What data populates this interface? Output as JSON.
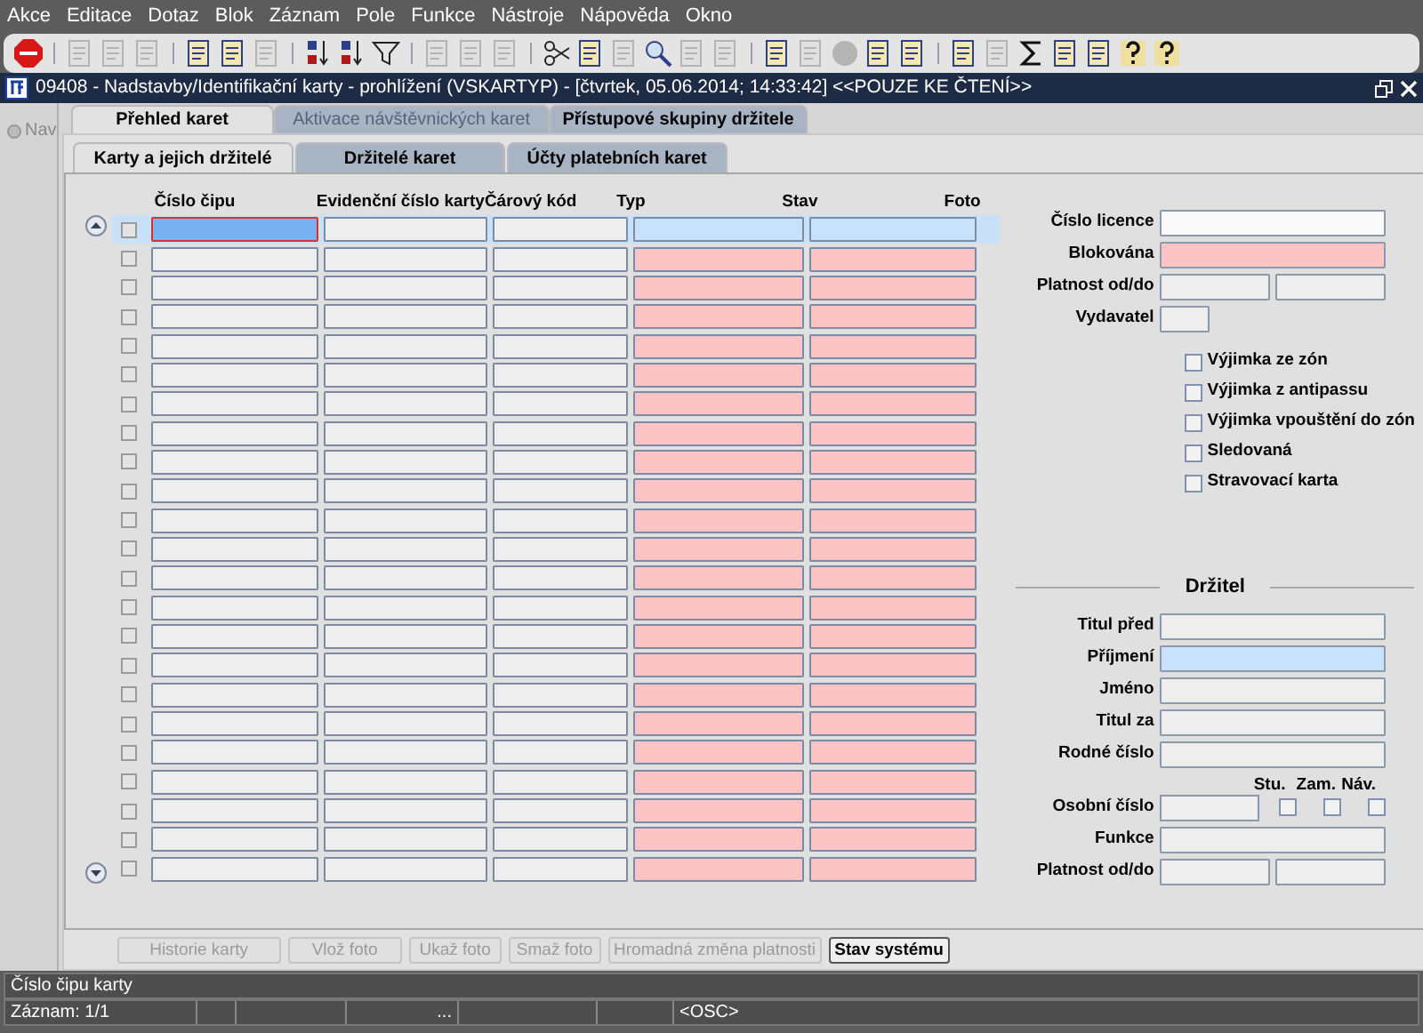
{
  "menu": [
    "Akce",
    "Editace",
    "Dotaz",
    "Blok",
    "Záznam",
    "Pole",
    "Funkce",
    "Nástroje",
    "Nápověda",
    "Okno"
  ],
  "toolbar": [
    [
      {
        "kind": "stop",
        "disabled": false
      }
    ],
    [
      {
        "kind": "doc",
        "disabled": true
      },
      {
        "kind": "doc",
        "disabled": true
      },
      {
        "kind": "doc",
        "disabled": true
      }
    ],
    [
      {
        "kind": "doc",
        "disabled": false
      },
      {
        "kind": "doc",
        "disabled": false
      },
      {
        "kind": "doc",
        "disabled": true
      }
    ],
    [
      {
        "kind": "sort",
        "disabled": false
      },
      {
        "kind": "sort",
        "disabled": false
      },
      {
        "kind": "filter",
        "disabled": false
      }
    ],
    [
      {
        "kind": "doc",
        "disabled": true
      },
      {
        "kind": "doc",
        "disabled": true
      },
      {
        "kind": "doc",
        "disabled": true
      }
    ],
    [
      {
        "kind": "scissors",
        "disabled": false
      },
      {
        "kind": "doc",
        "disabled": false
      },
      {
        "kind": "doc",
        "disabled": true
      },
      {
        "kind": "search",
        "disabled": false
      },
      {
        "kind": "doc",
        "disabled": true
      },
      {
        "kind": "doc",
        "disabled": true
      }
    ],
    [
      {
        "kind": "doc",
        "disabled": false
      },
      {
        "kind": "doc",
        "disabled": true
      },
      {
        "kind": "globe",
        "disabled": true
      },
      {
        "kind": "doc",
        "disabled": false
      },
      {
        "kind": "doc",
        "disabled": false
      }
    ],
    [
      {
        "kind": "doc",
        "disabled": false
      },
      {
        "kind": "doc",
        "disabled": true
      },
      {
        "kind": "sum",
        "disabled": false
      },
      {
        "kind": "doc",
        "disabled": false
      },
      {
        "kind": "doc",
        "disabled": false
      },
      {
        "kind": "help",
        "disabled": false
      },
      {
        "kind": "help",
        "disabled": false
      }
    ]
  ],
  "window": {
    "title": "09408 - Nadstavby/Identifikační karty - prohlížení (VSKARTYP) - [čtvrtek, 05.06.2014; 14:33:42] <<POUZE KE ČTENÍ>>"
  },
  "nav": {
    "label": "Nav",
    "disabled": true
  },
  "tabs": [
    {
      "label": "Přehled karet",
      "selected": true,
      "disabled": false
    },
    {
      "label": "Aktivace návštěvnických karet",
      "selected": false,
      "disabled": true
    },
    {
      "label": "Přístupové skupiny držitele",
      "selected": false,
      "disabled": false
    }
  ],
  "subtabs": [
    {
      "label": "Karty a jejich držitelé",
      "selected": true
    },
    {
      "label": "Držitelé karet",
      "selected": false
    },
    {
      "label": "Účty platebních karet",
      "selected": false
    }
  ],
  "table": {
    "columns": [
      {
        "label": "Číslo čipu",
        "required": false
      },
      {
        "label": "Evidenční číslo karty",
        "required": false
      },
      {
        "label": "Čárový kód",
        "required": false
      },
      {
        "label": "Typ",
        "required": true
      },
      {
        "label": "Stav",
        "required": true
      },
      {
        "label": "Foto"
      }
    ],
    "rows": [
      {
        "selected": true,
        "checked": false
      },
      {
        "selected": false,
        "checked": false
      },
      {
        "selected": false,
        "checked": false
      },
      {
        "selected": false,
        "checked": false
      },
      {
        "selected": false,
        "checked": false
      },
      {
        "selected": false,
        "checked": false
      },
      {
        "selected": false,
        "checked": false
      },
      {
        "selected": false,
        "checked": false
      },
      {
        "selected": false,
        "checked": false
      },
      {
        "selected": false,
        "checked": false
      },
      {
        "selected": false,
        "checked": false
      },
      {
        "selected": false,
        "checked": false
      },
      {
        "selected": false,
        "checked": false
      },
      {
        "selected": false,
        "checked": false
      },
      {
        "selected": false,
        "checked": false
      },
      {
        "selected": false,
        "checked": false
      },
      {
        "selected": false,
        "checked": false
      },
      {
        "selected": false,
        "checked": false
      },
      {
        "selected": false,
        "checked": false
      },
      {
        "selected": false,
        "checked": false
      },
      {
        "selected": false,
        "checked": false
      },
      {
        "selected": false,
        "checked": false
      },
      {
        "selected": false,
        "checked": false
      }
    ]
  },
  "card_fields": [
    {
      "label": "Číslo licence",
      "kind": "wide",
      "required": false,
      "highlighted": false
    },
    {
      "label": "Blokována",
      "kind": "wide",
      "required": true,
      "highlighted": false
    },
    {
      "label": "Platnost od/do",
      "kind": "pair",
      "required": false,
      "highlighted": false
    },
    {
      "label": "Vydavatel",
      "kind": "short",
      "required": false,
      "highlighted": false
    }
  ],
  "card_checkboxes": [
    {
      "label": "Výjimka ze zón",
      "checked": false
    },
    {
      "label": "Výjimka z antipassu",
      "checked": false
    },
    {
      "label": "Výjimka vpouštění do zón",
      "checked": false
    },
    {
      "label": "Sledovaná",
      "checked": false
    },
    {
      "label": "Stravovací karta",
      "checked": false
    }
  ],
  "holder": {
    "title": "Držitel",
    "fields": [
      {
        "label": "Titul před",
        "kind": "wide",
        "highlighted": false
      },
      {
        "label": "Příjmení",
        "kind": "wide",
        "highlighted": true
      },
      {
        "label": "Jméno",
        "kind": "wide",
        "highlighted": false
      },
      {
        "label": "Titul za",
        "kind": "wide",
        "highlighted": false
      },
      {
        "label": "Rodné číslo",
        "kind": "wide",
        "highlighted": false
      }
    ],
    "flags": [
      {
        "label": "Stu.",
        "checked": false
      },
      {
        "label": "Zam.",
        "checked": false
      },
      {
        "label": "Náv.",
        "checked": false
      }
    ],
    "personal_number_label": "Osobní číslo",
    "more_fields": [
      {
        "label": "Funkce",
        "kind": "wide",
        "highlighted": false
      },
      {
        "label": "Platnost od/do",
        "kind": "pair",
        "highlighted": false
      }
    ]
  },
  "buttons": [
    {
      "label": "Historie karty",
      "disabled": true
    },
    {
      "label": "Vlož foto",
      "disabled": true
    },
    {
      "label": "Ukaž foto",
      "disabled": true
    },
    {
      "label": "Smaž foto",
      "disabled": true
    },
    {
      "label": "Hromadná změna platnosti",
      "disabled": true
    },
    {
      "label": "Stav systému",
      "disabled": false
    }
  ],
  "status_bar": {
    "message": "Číslo čipu karty",
    "record": "Záznam: 1/1",
    "segment_4": "...",
    "mode": "<OSC>"
  }
}
